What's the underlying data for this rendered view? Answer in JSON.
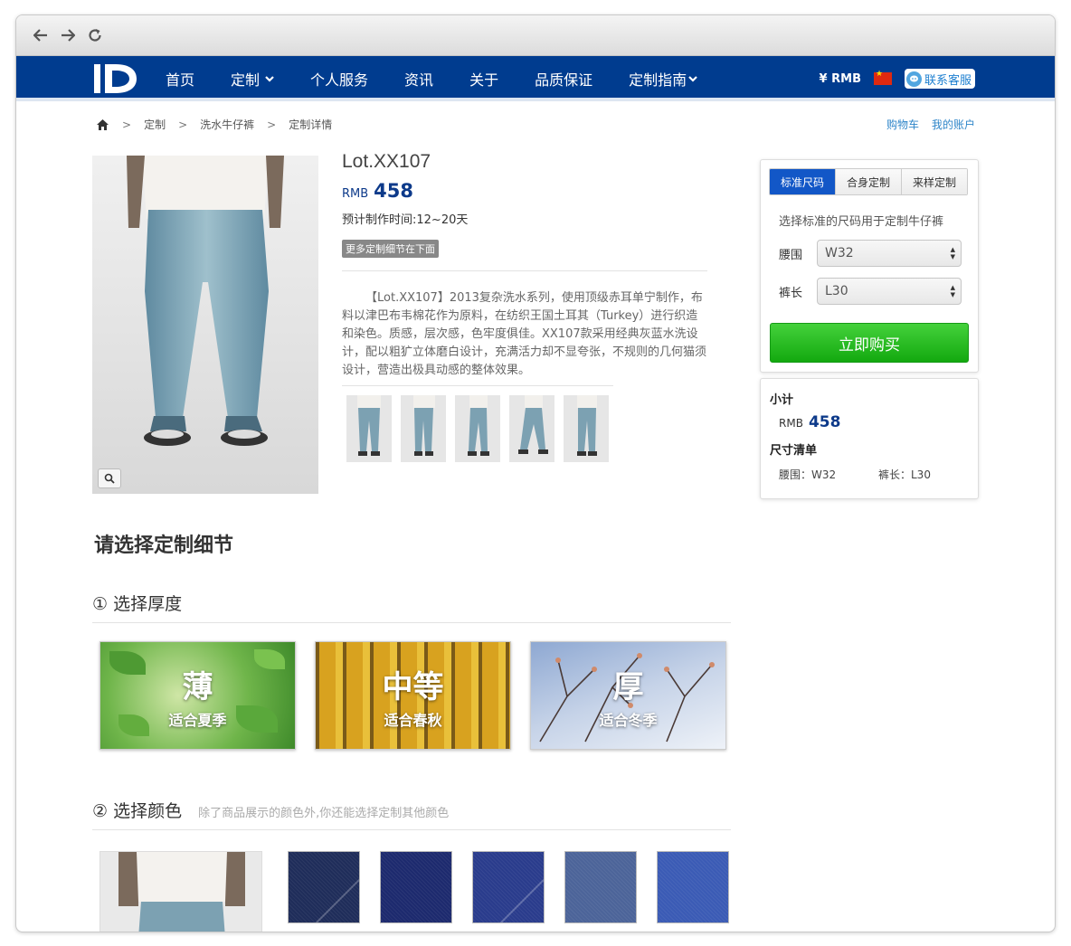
{
  "nav": {
    "logo": "ID",
    "items": [
      "首页",
      "定制",
      "个人服务",
      "资讯",
      "关于",
      "品质保证",
      "定制指南"
    ],
    "currency": "¥ RMB",
    "service": "联系客服"
  },
  "breadcrumb": [
    "定制",
    "洗水牛仔裤",
    "定制详情"
  ],
  "account_links": [
    "购物车",
    "我的账户"
  ],
  "product": {
    "title": "Lot.XX107",
    "currency": "RMB",
    "price": "458",
    "lead_time": "预计制作时间:12~20天",
    "tag": "更多定制细节在下面",
    "description": "【Lot.XX107】2013复杂洗水系列，使用顶级赤耳单宁制作，布料以津巴布韦棉花作为原料，在纺织王国土耳其（Turkey）进行织造和染色。质感，层次感，色牢度俱佳。XX107款采用经典灰蓝水洗设计，配以粗犷立体磨白设计，充满活力却不显夸张，不规则的几何猫须设计，营造出极具动感的整体效果。"
  },
  "buy_panel": {
    "tabs": [
      "标准尺码",
      "合身定制",
      "来样定制"
    ],
    "hint": "选择标准的尺码用于定制牛仔裤",
    "waist_label": "腰围",
    "waist_value": "W32",
    "length_label": "裤长",
    "length_value": "L30",
    "buy_label": "立即购买"
  },
  "summary": {
    "subtotal_label": "小计",
    "currency": "RMB",
    "price": "458",
    "size_list_label": "尺寸清单",
    "waist": "腰围：W32",
    "length": "裤长：L30"
  },
  "section_title": "请选择定制细节",
  "step1": {
    "title": "① 选择厚度",
    "options": [
      {
        "big": "薄",
        "small": "适合夏季"
      },
      {
        "big": "中等",
        "small": "适合春秋"
      },
      {
        "big": "厚",
        "small": "适合冬季"
      }
    ]
  },
  "step2": {
    "title": "② 选择颜色",
    "hint": "除了商品展示的颜色外,你还能选择定制其他颜色",
    "swatches": [
      "#1f2d5a",
      "#1d2a6e",
      "#2a3c8c",
      "#4c6499",
      "#3b5bb5"
    ]
  },
  "colors": {
    "nav_bg": "#003c8f",
    "price": "#0d3a8a",
    "buy": "#22b51c",
    "tab_active": "#1257c7"
  }
}
